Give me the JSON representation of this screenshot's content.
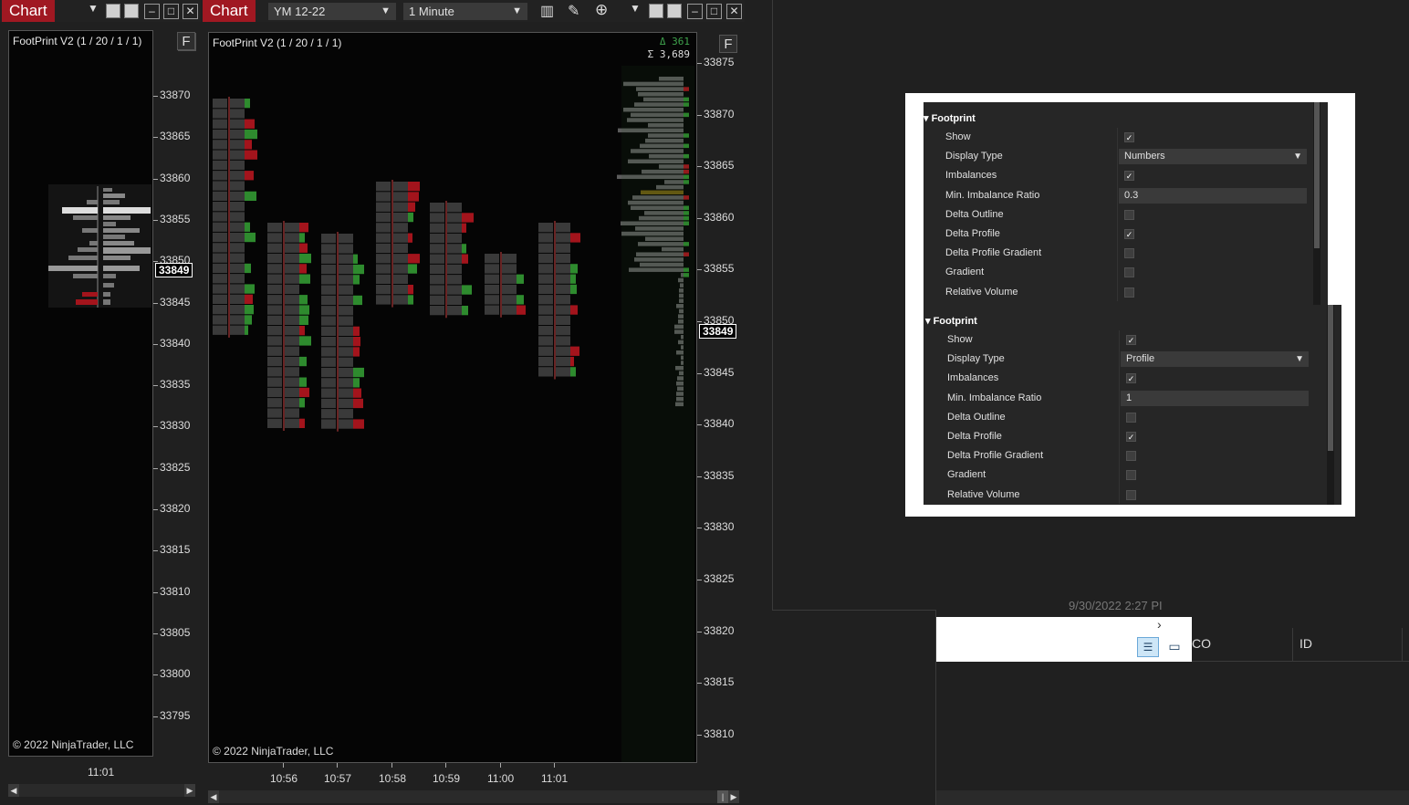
{
  "left_window": {
    "tab_label": "Chart",
    "plot_title": "FootPrint V2 (1 / 20 / 1 / 1)",
    "f_button": "F",
    "copyright": "© 2022 NinjaTrader, LLC",
    "time_label": "11:01",
    "price_ticks": [
      "33870",
      "33865",
      "33860",
      "33855",
      "33850",
      "33845",
      "33840",
      "33835",
      "33830",
      "33825",
      "33820",
      "33815",
      "33810",
      "33805",
      "33800",
      "33795"
    ],
    "current_price": "33849"
  },
  "main_window": {
    "tab_label": "Chart",
    "instrument": "YM 12-22",
    "interval": "1 Minute",
    "plot_title": "FootPrint V2 (1 / 20 / 1 / 1)",
    "f_button": "F",
    "delta_label": "Δ 361",
    "sum_label": "Σ 3,689",
    "copyright": "© 2022 NinjaTrader, LLC",
    "current_price": "33849",
    "price_ticks": [
      "33875",
      "33870",
      "33865",
      "33860",
      "33855",
      "33850",
      "33845",
      "33840",
      "33835",
      "33830",
      "33825",
      "33820",
      "33815",
      "33810"
    ],
    "time_ticks": [
      "10:56",
      "10:57",
      "10:58",
      "10:59",
      "11:00",
      "11:01"
    ],
    "colors": {
      "buy": "#2e8b2e",
      "sell": "#a3141c",
      "neutral": "#5c5c5c",
      "poc": "#6b5a10"
    }
  },
  "settings_a": {
    "header": "Footprint",
    "rows": [
      {
        "label": "Show",
        "type": "check",
        "checked": true
      },
      {
        "label": "Display Type",
        "type": "select",
        "value": "Numbers"
      },
      {
        "label": "Imbalances",
        "type": "check",
        "checked": true
      },
      {
        "label": "Min. Imbalance Ratio",
        "type": "input",
        "value": "0.3"
      },
      {
        "label": "Delta Outline",
        "type": "check",
        "checked": false
      },
      {
        "label": "Delta Profile",
        "type": "check",
        "checked": true
      },
      {
        "label": "Delta Profile Gradient",
        "type": "check",
        "checked": false
      },
      {
        "label": "Gradient",
        "type": "check",
        "checked": false
      },
      {
        "label": "Relative Volume",
        "type": "check",
        "checked": false
      }
    ]
  },
  "settings_b": {
    "header": "Footprint",
    "rows": [
      {
        "label": "Show",
        "type": "check",
        "checked": true
      },
      {
        "label": "Display Type",
        "type": "select",
        "value": "Profile"
      },
      {
        "label": "Imbalances",
        "type": "check",
        "checked": true
      },
      {
        "label": "Min. Imbalance Ratio",
        "type": "input",
        "value": "1"
      },
      {
        "label": "Delta Outline",
        "type": "check",
        "checked": false
      },
      {
        "label": "Delta Profile",
        "type": "check",
        "checked": true
      },
      {
        "label": "Delta Profile Gradient",
        "type": "check",
        "checked": false
      },
      {
        "label": "Gradient",
        "type": "check",
        "checked": false
      },
      {
        "label": "Relative Volume",
        "type": "check",
        "checked": false
      }
    ]
  },
  "background_grid": {
    "col_co": "CO",
    "col_id": "ID",
    "faded_timestamp": "9/30/2022 2:27 PI"
  }
}
